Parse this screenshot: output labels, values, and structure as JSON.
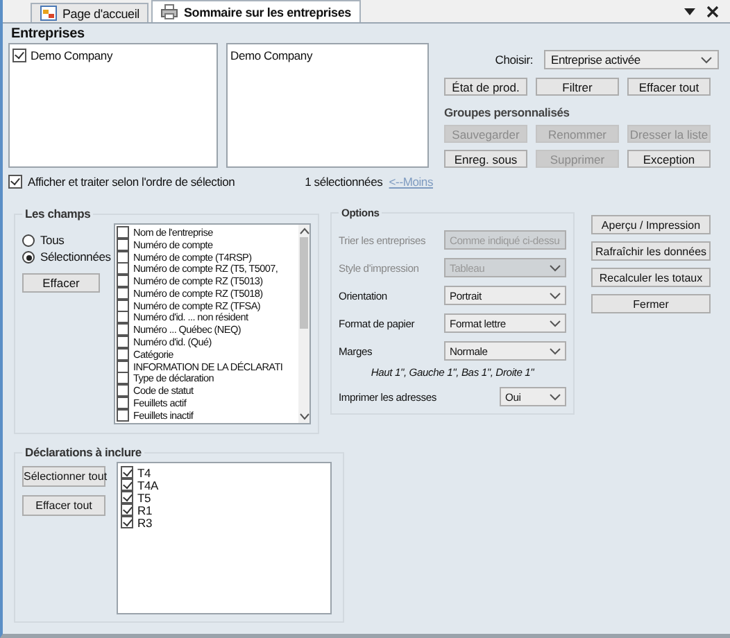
{
  "tabs": [
    {
      "label": "Page d'accueil",
      "selected": false,
      "kind": "home"
    },
    {
      "label": "Sommaire sur les entreprises",
      "selected": true,
      "kind": "doc"
    }
  ],
  "entreprises": {
    "title": "Entreprises",
    "available": [
      {
        "label": "Demo Company",
        "checked": true
      }
    ],
    "chosen": [
      "Demo Company"
    ],
    "order_option": {
      "label": "Afficher et traiter selon l'ordre de sélection",
      "checked": true
    },
    "count": "1 sélectionnées",
    "less_link": "<--Moins"
  },
  "chooser": {
    "label": "Choisir:",
    "value": "Entreprise activée"
  },
  "top_buttons": [
    {
      "label": "État de prod.",
      "disabled": false
    },
    {
      "label": "Filtrer",
      "disabled": false
    },
    {
      "label": "Effacer tout",
      "disabled": false
    }
  ],
  "groups": {
    "title": "Groupes personnalisés",
    "buttons": [
      {
        "label": "Sauvegarder",
        "disabled": true
      },
      {
        "label": "Renommer",
        "disabled": true
      },
      {
        "label": "Dresser la liste",
        "disabled": true
      },
      {
        "label": "Enreg. sous",
        "disabled": false
      },
      {
        "label": "Supprimer",
        "disabled": true
      },
      {
        "label": "Exception",
        "disabled": false
      }
    ]
  },
  "fields": {
    "title": "Les champs",
    "radios": [
      {
        "label": "Tous",
        "selected": false
      },
      {
        "label": "Sélectionnées",
        "selected": true
      }
    ],
    "clear_button": "Effacer",
    "items": [
      {
        "label": "Nom de l'entreprise",
        "checked": false
      },
      {
        "label": "Numéro de compte",
        "checked": false
      },
      {
        "label": "Numéro de compte  (T4RSP)",
        "checked": false
      },
      {
        "label": "Numéro de compte RZ (T5, T5007,",
        "checked": false
      },
      {
        "label": "Numéro de compte RZ (T5013)",
        "checked": false
      },
      {
        "label": "Numéro de compte RZ (T5018)",
        "checked": false
      },
      {
        "label": "Numéro de compte RZ (TFSA)",
        "checked": false
      },
      {
        "label": "Numéro d'id. ... non résident",
        "checked": false
      },
      {
        "label": "Numéro ... Québec (NEQ)",
        "checked": false
      },
      {
        "label": "Numéro d'id. (Qué)",
        "checked": false
      },
      {
        "label": "Catégorie",
        "checked": false
      },
      {
        "label": "INFORMATION DE LA DÉCLARATI",
        "checked": false
      },
      {
        "label": "Type de déclaration",
        "checked": false
      },
      {
        "label": "Code de statut",
        "checked": false
      },
      {
        "label": "Feuillets actif",
        "checked": false
      },
      {
        "label": "Feuillets inactif",
        "checked": false
      }
    ]
  },
  "options": {
    "title": "Options",
    "rows": [
      {
        "label": "Trier les entreprises",
        "value": "Comme indiqué ci-dessu",
        "disabled": true
      },
      {
        "label": "Style d'impression",
        "value": "Tableau",
        "disabled": true
      },
      {
        "label": "Orientation",
        "value": "Portrait",
        "disabled": false
      },
      {
        "label": "Format de papier",
        "value": "Format lettre",
        "disabled": false
      },
      {
        "label": "Marges",
        "value": "Normale",
        "disabled": false
      }
    ],
    "margins_note": "Haut 1\", Gauche 1\", Bas 1\", Droite 1\"",
    "print_addresses": {
      "label": "Imprimer les adresses",
      "value": "Oui"
    }
  },
  "actions": [
    "Aperçu / Impression",
    "Rafraîchir les données",
    "Recalculer les totaux",
    "Fermer"
  ],
  "declarations": {
    "title": "Déclarations à inclure",
    "buttons": [
      "Sélectionner tout",
      "Effacer tout"
    ],
    "items": [
      {
        "label": "T4",
        "checked": true
      },
      {
        "label": "T4A",
        "checked": true
      },
      {
        "label": "T5",
        "checked": true
      },
      {
        "label": "R1",
        "checked": true
      },
      {
        "label": "R3",
        "checked": true
      }
    ]
  }
}
